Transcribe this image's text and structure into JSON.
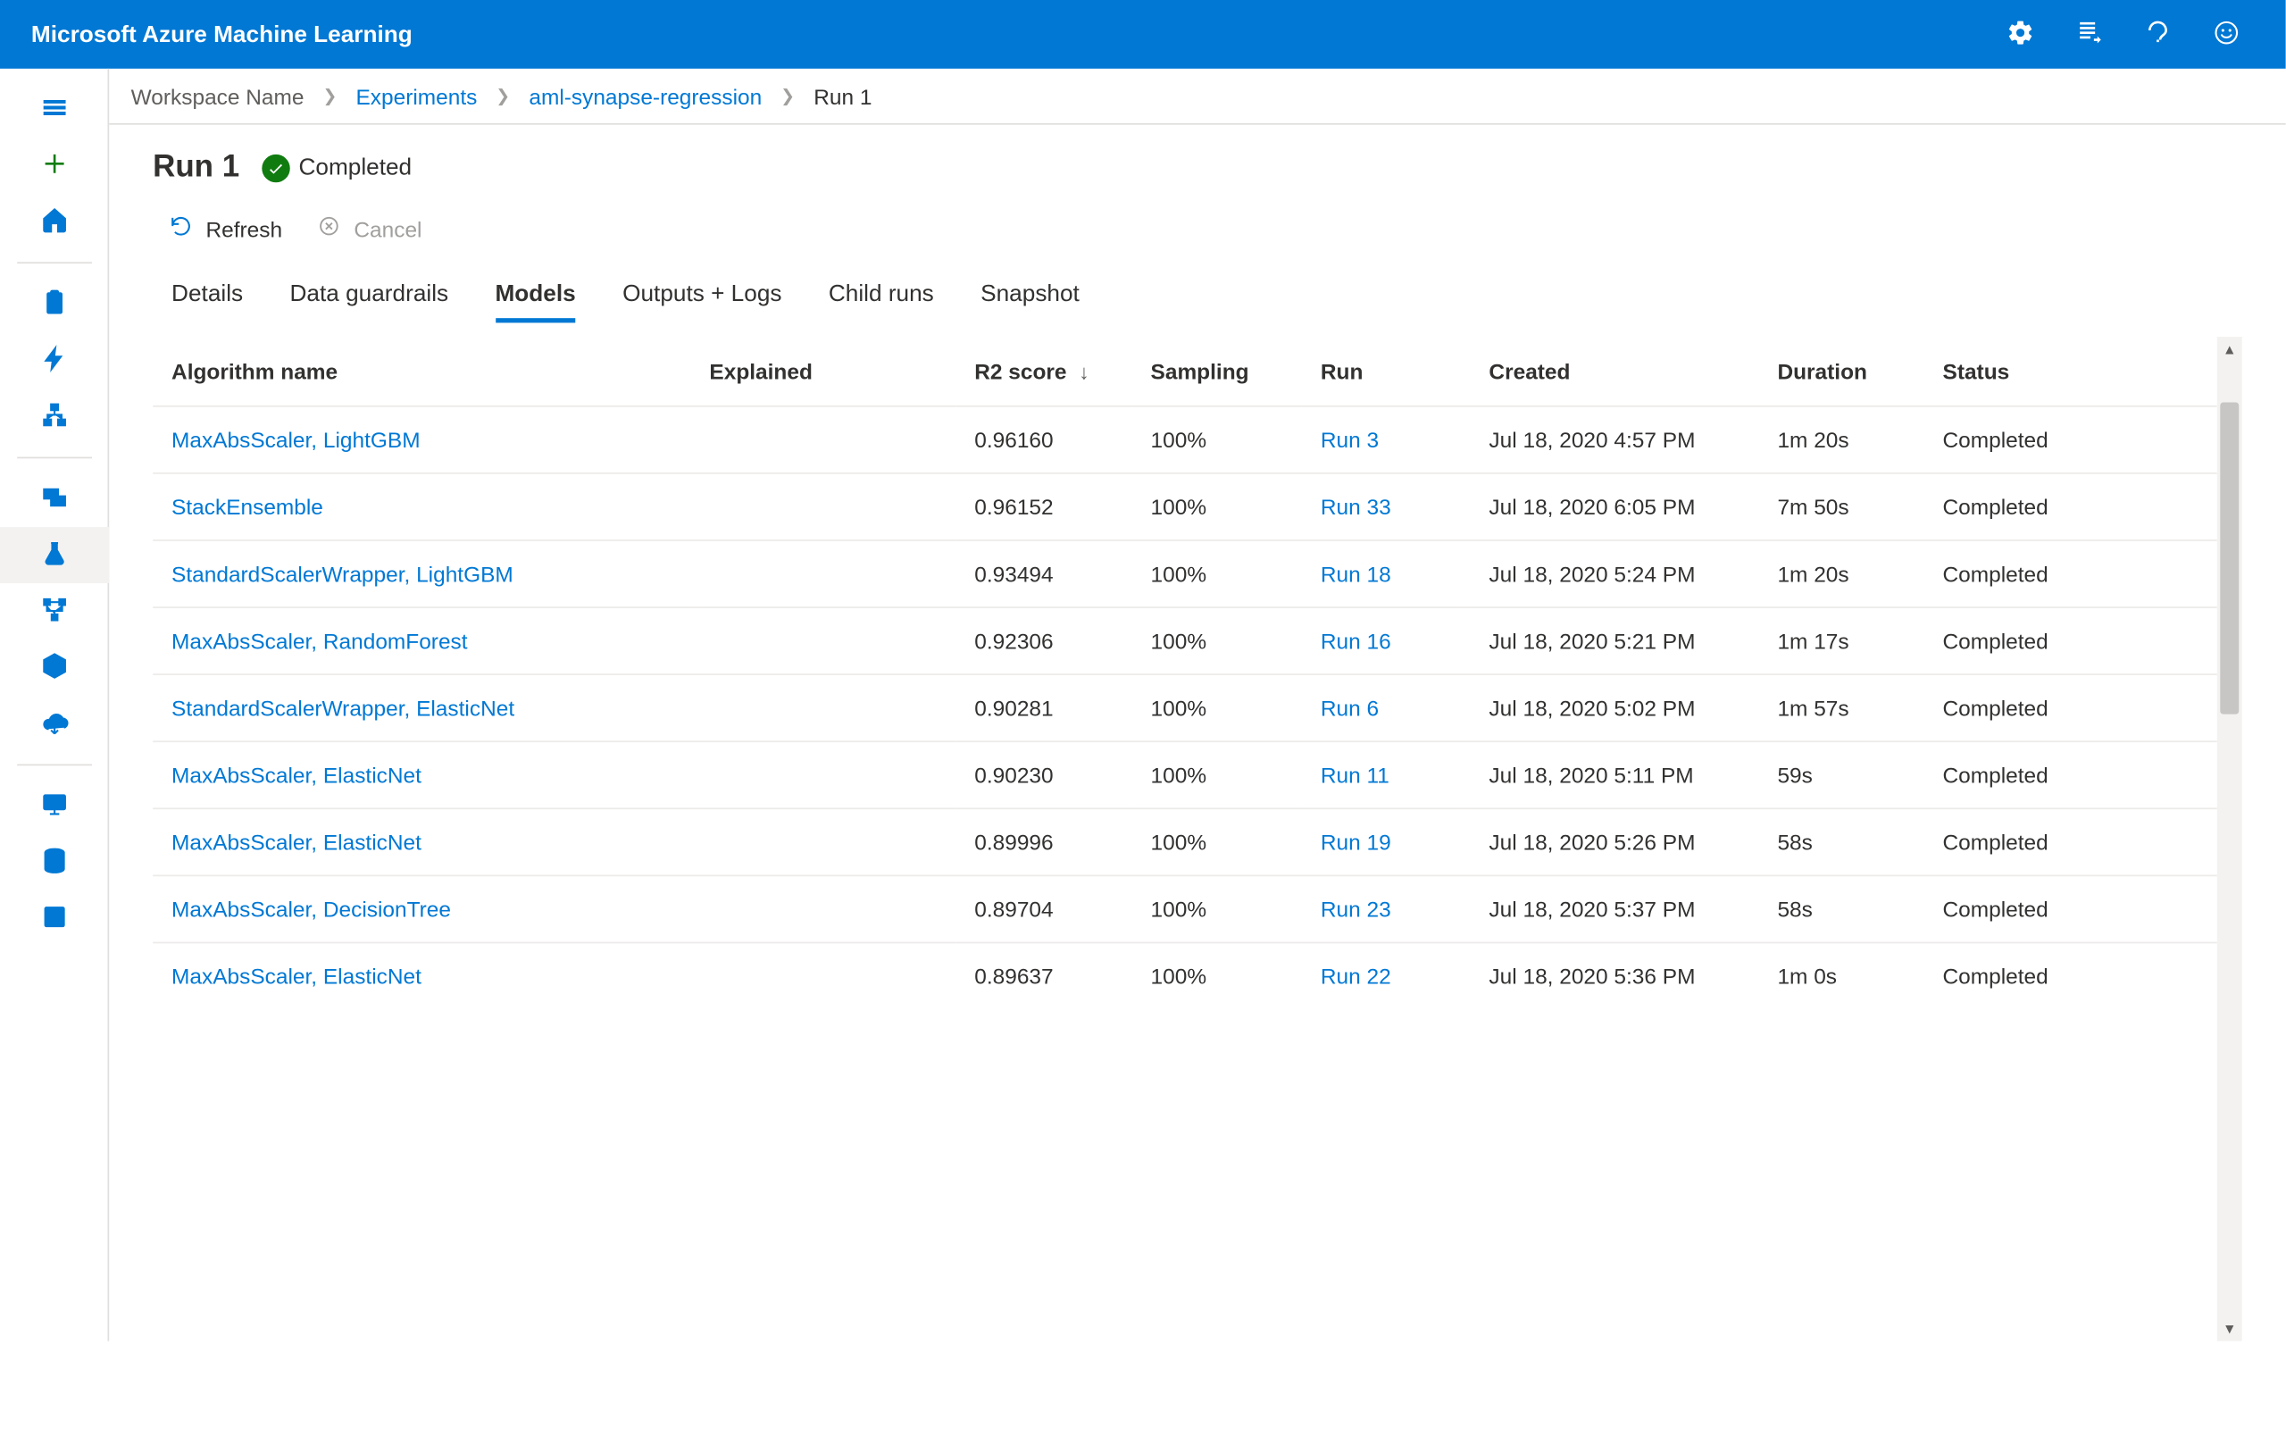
{
  "header": {
    "title": "Microsoft Azure Machine Learning"
  },
  "breadcrumb": {
    "items": [
      {
        "label": "Workspace Name",
        "link": false
      },
      {
        "label": "Experiments",
        "link": true
      },
      {
        "label": "aml-synapse-regression",
        "link": true
      },
      {
        "label": "Run 1",
        "link": false,
        "current": true
      }
    ]
  },
  "run": {
    "title": "Run 1",
    "status_label": "Completed"
  },
  "toolbar": {
    "refresh_label": "Refresh",
    "cancel_label": "Cancel"
  },
  "tabs": [
    {
      "label": "Details"
    },
    {
      "label": "Data guardrails"
    },
    {
      "label": "Models",
      "active": true
    },
    {
      "label": "Outputs + Logs"
    },
    {
      "label": "Child runs"
    },
    {
      "label": "Snapshot"
    }
  ],
  "table": {
    "columns": {
      "algorithm": "Algorithm name",
      "explained": "Explained",
      "r2": "R2 score",
      "sampling": "Sampling",
      "run": "Run",
      "created": "Created",
      "duration": "Duration",
      "status": "Status"
    },
    "sort_indicator": "↓",
    "rows": [
      {
        "algorithm": "MaxAbsScaler, LightGBM",
        "explained": "",
        "r2": "0.96160",
        "sampling": "100%",
        "run": "Run 3",
        "created": "Jul 18, 2020 4:57 PM",
        "duration": "1m 20s",
        "status": "Completed"
      },
      {
        "algorithm": "StackEnsemble",
        "explained": "",
        "r2": "0.96152",
        "sampling": "100%",
        "run": "Run 33",
        "created": "Jul 18, 2020 6:05 PM",
        "duration": "7m 50s",
        "status": "Completed"
      },
      {
        "algorithm": "StandardScalerWrapper, LightGBM",
        "explained": "",
        "r2": "0.93494",
        "sampling": "100%",
        "run": "Run 18",
        "created": "Jul 18, 2020 5:24 PM",
        "duration": "1m 20s",
        "status": "Completed"
      },
      {
        "algorithm": "MaxAbsScaler, RandomForest",
        "explained": "",
        "r2": "0.92306",
        "sampling": "100%",
        "run": "Run 16",
        "created": "Jul 18, 2020 5:21 PM",
        "duration": "1m 17s",
        "status": "Completed"
      },
      {
        "algorithm": "StandardScalerWrapper, ElasticNet",
        "explained": "",
        "r2": "0.90281",
        "sampling": "100%",
        "run": "Run 6",
        "created": "Jul 18, 2020 5:02 PM",
        "duration": "1m 57s",
        "status": "Completed"
      },
      {
        "algorithm": "MaxAbsScaler, ElasticNet",
        "explained": "",
        "r2": "0.90230",
        "sampling": "100%",
        "run": "Run 11",
        "created": "Jul 18, 2020 5:11 PM",
        "duration": "59s",
        "status": "Completed"
      },
      {
        "algorithm": "MaxAbsScaler, ElasticNet",
        "explained": "",
        "r2": "0.89996",
        "sampling": "100%",
        "run": "Run 19",
        "created": "Jul 18, 2020 5:26 PM",
        "duration": "58s",
        "status": "Completed"
      },
      {
        "algorithm": "MaxAbsScaler, DecisionTree",
        "explained": "",
        "r2": "0.89704",
        "sampling": "100%",
        "run": "Run 23",
        "created": "Jul 18, 2020 5:37 PM",
        "duration": "58s",
        "status": "Completed"
      },
      {
        "algorithm": "MaxAbsScaler, ElasticNet",
        "explained": "",
        "r2": "0.89637",
        "sampling": "100%",
        "run": "Run 22",
        "created": "Jul 18, 2020 5:36 PM",
        "duration": "1m 0s",
        "status": "Completed"
      }
    ]
  }
}
